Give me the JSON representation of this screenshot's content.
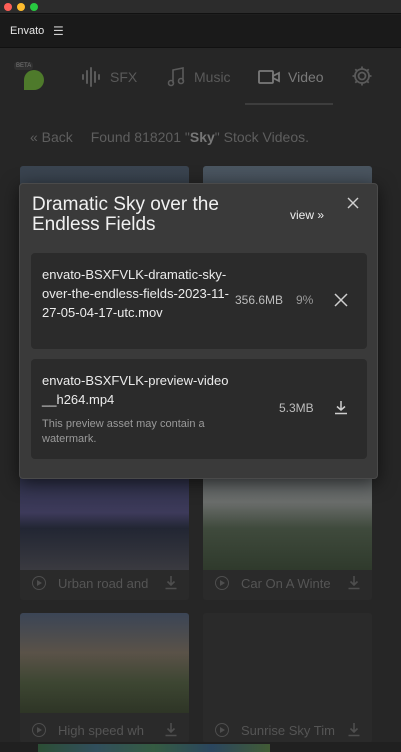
{
  "window": {
    "app_title": "Envato"
  },
  "nav": {
    "beta_badge": "BETA",
    "tabs": [
      {
        "label": "SFX",
        "icon": "waveform-icon"
      },
      {
        "label": "Music",
        "icon": "music-note-icon"
      },
      {
        "label": "Video",
        "icon": "video-camera-icon",
        "active": true
      }
    ],
    "settings_icon": "gear-icon"
  },
  "results": {
    "back_label": "« Back",
    "prefix": "Found 818201 \"",
    "query": "Sky",
    "suffix": "\" Stock Videos."
  },
  "cards": [
    {
      "title": "Urban road and"
    },
    {
      "title": "Car On A Winte"
    },
    {
      "title": "High speed wh"
    },
    {
      "title": "Sunrise Sky Tim"
    }
  ],
  "dialog": {
    "title": "Dramatic Sky over the Endless Fields",
    "view_label": "view »",
    "files": [
      {
        "name": "envato-BSXFVLK-dramatic-sky-over-the-endless-fields-2023-11-27-05-04-17-utc.mov",
        "size": "356.6MB",
        "progress_label": "9%",
        "progress": 0.09,
        "action_icon": "cancel-icon"
      },
      {
        "name": "envato-BSXFVLK-preview-video__h264.mp4",
        "size": "5.3MB",
        "note": "This preview asset may contain a watermark.",
        "action_icon": "download-icon"
      }
    ]
  },
  "colors": {
    "accent_logo": "#4e7a2b",
    "dialog_bg": "#3a3a3a",
    "file_box_bg": "#2b2b2b"
  }
}
